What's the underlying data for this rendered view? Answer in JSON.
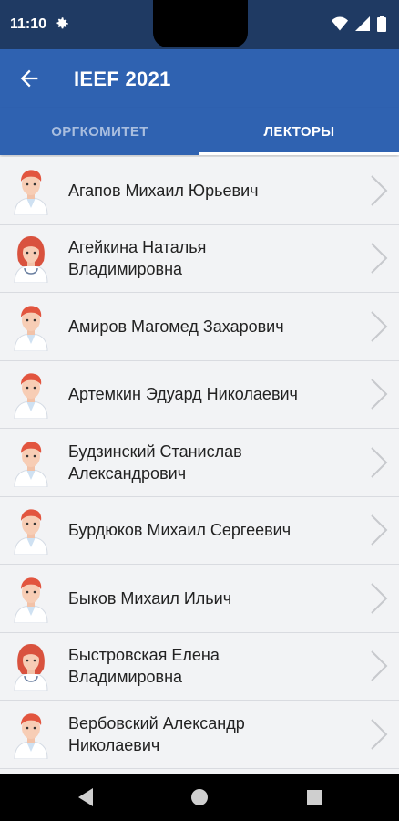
{
  "status": {
    "time": "11:10",
    "icons": [
      "gear-icon",
      "wifi-icon",
      "signal-icon",
      "battery-icon"
    ]
  },
  "header": {
    "title": "IEEF 2021",
    "back_icon": "arrow-left-icon"
  },
  "tabs": [
    {
      "label": "ОРГКОМИТЕТ",
      "active": false
    },
    {
      "label": "ЛЕКТОРЫ",
      "active": true
    }
  ],
  "lecturers": [
    {
      "name_line1": "Агапов Михаил Юрьевич",
      "name_line2": "",
      "avatar": "male-doctor-avatar"
    },
    {
      "name_line1": "Агейкина Наталья",
      "name_line2": "Владимировна",
      "avatar": "female-doctor-avatar"
    },
    {
      "name_line1": "Амиров Магомед Захарович",
      "name_line2": "",
      "avatar": "male-doctor-avatar"
    },
    {
      "name_line1": "Артемкин Эдуард Николаевич",
      "name_line2": "",
      "avatar": "male-doctor-avatar"
    },
    {
      "name_line1": "Будзинский Станислав",
      "name_line2": "Александрович",
      "avatar": "male-doctor-avatar"
    },
    {
      "name_line1": "Бурдюков Михаил Сергеевич",
      "name_line2": "",
      "avatar": "male-doctor-avatar"
    },
    {
      "name_line1": "Быков Михаил Ильич",
      "name_line2": "",
      "avatar": "male-doctor-avatar"
    },
    {
      "name_line1": "Быстровская Елена",
      "name_line2": "Владимировна",
      "avatar": "female-doctor-avatar"
    },
    {
      "name_line1": "Вербовский Александр",
      "name_line2": "Николаевич",
      "avatar": "male-doctor-avatar"
    }
  ],
  "colors": {
    "status_bar": "#1f3a63",
    "app_bar": "#2f62b1",
    "tab_inactive": "#a9bedf",
    "background": "#f2f3f5"
  }
}
